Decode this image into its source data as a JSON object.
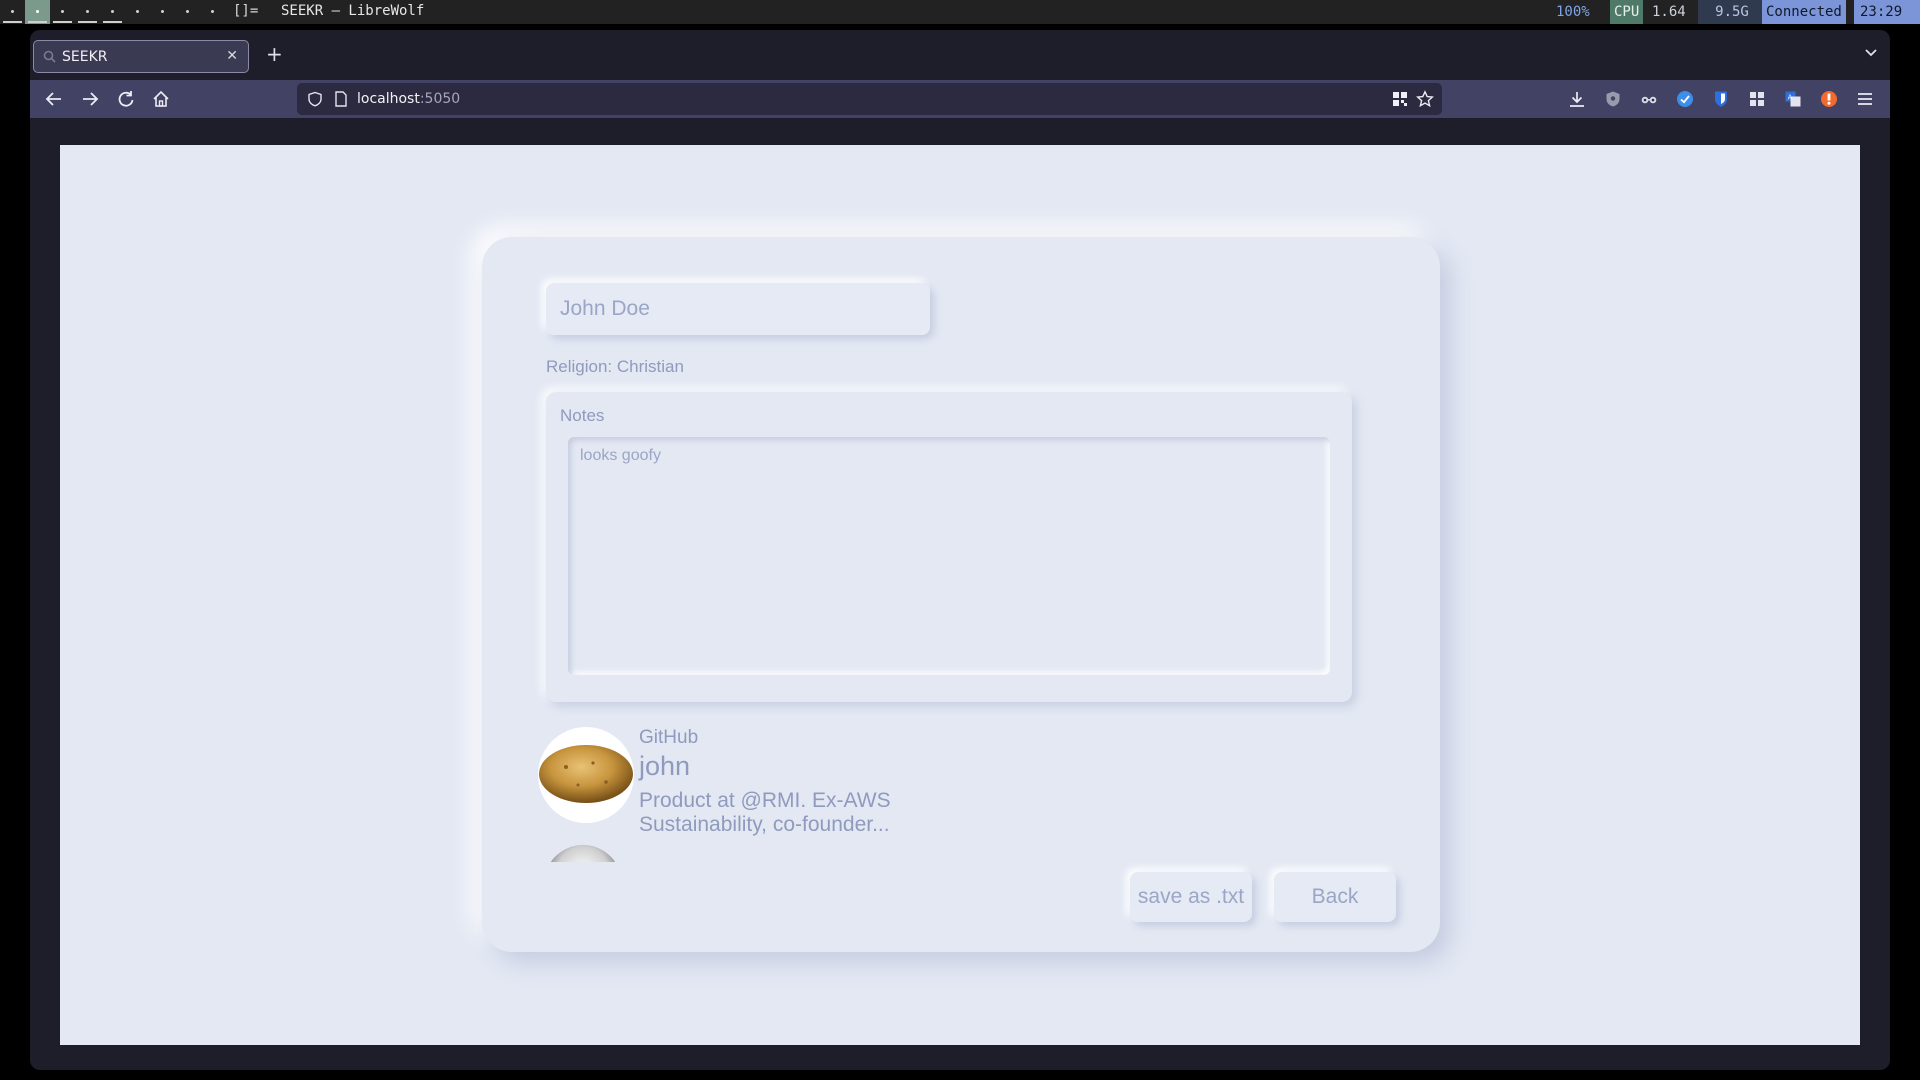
{
  "sysbar": {
    "layout": "[]=",
    "window_title": "SEEKR — LibreWolf",
    "volume": "100%",
    "cpu_label": "CPU",
    "cpu_load": "1.64",
    "memory": "9.5G",
    "network": "Connected",
    "clock": "23:29",
    "colors": {
      "bar": "#222222",
      "active_ws": "#7b9a8c",
      "cpu_label_bg": "#4f7a6a",
      "mem_bg": "#2f3a4e",
      "network_bg": "#7c95d8"
    }
  },
  "browser": {
    "tab_title": "SEEKR",
    "url_host": "localhost",
    "url_port": ":5050",
    "toolbar_icons": [
      "back-icon",
      "forward-icon",
      "reload-icon",
      "home-icon"
    ],
    "extension_icons": [
      "download-icon",
      "extension-shield-icon",
      "extension-glasses-icon",
      "extension-blue-check-icon",
      "bitwarden-icon",
      "extension-grid-icon",
      "translate-icon",
      "ublock-icon",
      "menu-icon"
    ]
  },
  "page": {
    "name_value": "John Doe",
    "religion": "Religion: Christian",
    "notes_label": "Notes",
    "notes_value": "looks goofy",
    "profiles": [
      {
        "platform": "GitHub",
        "username": "john",
        "bio": "Product at @RMI. Ex-AWS Sustainability, co-founder..."
      }
    ],
    "save_button": "save as .txt",
    "back_button": "Back",
    "colors": {
      "background": "#e3e8f3",
      "text": "#8f9bbe"
    }
  }
}
